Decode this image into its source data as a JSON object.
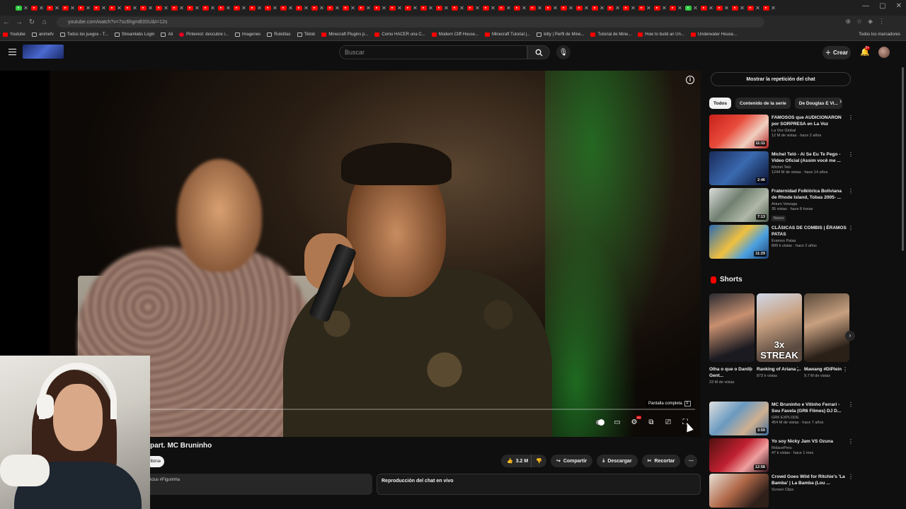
{
  "browser": {
    "url": "youtube.com/watch?v=7sc6hgmB3SU&t=12s",
    "bookmarks": [
      "Youtube",
      "animefv",
      "Todos los juegos - T...",
      "Streamlabs Login",
      "Ali",
      "Pinterest: descubre i...",
      "Imagenes",
      "Ruletitas",
      "Tiktok",
      "Minecraft Plugins p...",
      "Como HACER una C...",
      "Modern Cliff House...",
      "Minecraft Tutorial |...",
      "kitty | Perfil de Mine...",
      "Tutorial de Mine...",
      "How to build an Un...",
      "Underwater House..."
    ],
    "bookmarks_right": "Todos los marcadores"
  },
  "header": {
    "search_placeholder": "Buscar",
    "create_label": "Crear",
    "notifications_count": "9+"
  },
  "player": {
    "tooltip": "Pantalla completa",
    "tooltip_key": "F",
    "hd_badge": "HD"
  },
  "video": {
    "title": "part. MC Bruninho",
    "subscribe_label": "ribirse",
    "likes": "3.2 M",
    "share_label": "Compartir",
    "download_label": "Descargar",
    "clip_label": "Recortar",
    "description_snippet": "icius #Figurinha",
    "chat_title": "Reproducción del chat en vivo"
  },
  "sidebar": {
    "chat_replay_label": "Mostrar la repetición del chat",
    "chips": [
      "Todos",
      "Contenido de la serie",
      "De Douglas E Vi..."
    ],
    "recs_top": [
      {
        "title": "FAMOSOS que AUDICIONARON por SORPRESA en La Voz",
        "channel": "La Voz Global",
        "views": "12 M de vistas · hace 2 años",
        "duration": "11:11",
        "badge": ""
      },
      {
        "title": "Michel Teló - Ai Se Eu Te Pego - Video Oficial (Assim você me ...",
        "channel": "Michel Teló",
        "views": "1244 M de vistas · hace 14 años",
        "duration": "2:46",
        "badge": ""
      },
      {
        "title": "Fraternidad Folklórica Boliviana de Rhode Island, Tobas 2005- ...",
        "channel": "Arturo Veizaga",
        "views": "35 vistas · hace 8 horas",
        "duration": "7:13",
        "badge": "Nuevo"
      },
      {
        "title": "CLÁSICAS DE COMBIS | ÉRAMOS PATAS",
        "channel": "Éramos Patas",
        "views": "899 k vistas · hace 2 años",
        "duration": "11:29",
        "badge": ""
      }
    ],
    "shorts_title": "Shorts",
    "shorts": [
      {
        "title": "Olha o que o Danilo Gent...",
        "views": "23 M de vistas",
        "overlay": ""
      },
      {
        "title": "Ranking of Ariana ...",
        "views": "873 k vistas",
        "overlay": "3x STREAK"
      },
      {
        "title": "Mawang #DiPlein",
        "views": "9.7 M de vistas",
        "overlay": ""
      }
    ],
    "recs_bottom": [
      {
        "title": "MC Bruninho e Vitinho Ferrari - Sou Favela (GR6 Filmes) DJ D...",
        "channel": "GR6 EXPLODE",
        "views": "454 M de vistas · hace 7 años",
        "duration": "3:59"
      },
      {
        "title": "Yo soy Nicky Jam VS Ozuna",
        "channel": "RidacePeru",
        "views": "47 k vistas · hace 1 mes",
        "duration": "12:58"
      },
      {
        "title": "Crowd Goes Wild for Ritchie's 'La Bamba' | La Bamba (Lou ...",
        "channel": "Screen Clips",
        "views": "",
        "duration": ""
      }
    ]
  }
}
